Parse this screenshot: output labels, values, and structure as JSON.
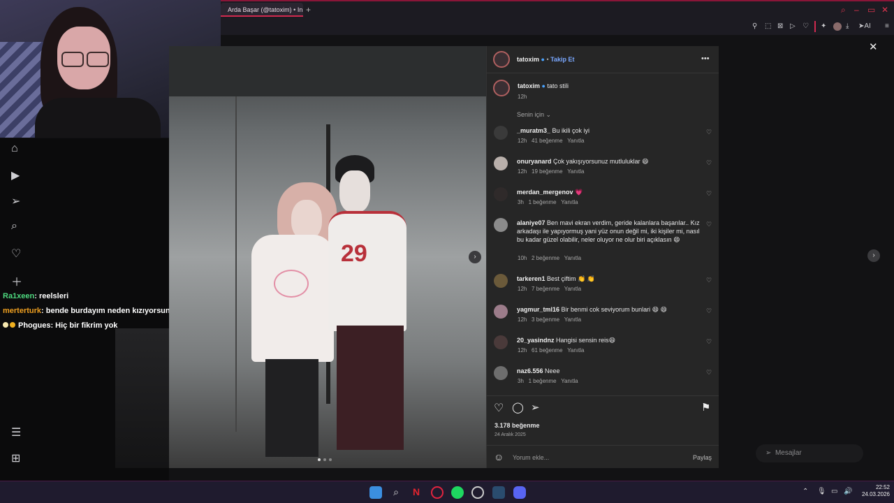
{
  "browser": {
    "tab_title": "Arda Başar (@tatoxim) • In",
    "tab_plus": "+",
    "ai_label": "AI"
  },
  "chat": {
    "messages": [
      {
        "user": "Ra1xeen",
        "text": ": reelsleri",
        "color": "#4ed97f"
      },
      {
        "user": "merterturk",
        "text": ": bende burdayım neden kızıyorsun ki",
        "color": "#f0a020"
      },
      {
        "user": "Phogues",
        "text": ": Hiç bir fikrim yok",
        "color": "#ffffff"
      }
    ]
  },
  "post": {
    "author": "tatoxim",
    "follow_label": "Takip Et",
    "caption": "tato stili",
    "caption_time": "12h",
    "filter_label": "Senin için",
    "likes": "3.178 beğenme",
    "date": "24 Aralık 2025",
    "comment_placeholder": "Yorum ekle...",
    "share_label": "Paylaş",
    "jersey_number": "29"
  },
  "comments": [
    {
      "user": "_muratm3_",
      "text": "Bu ikili çok iyi",
      "time": "12h",
      "likes": "41 beğenme",
      "reply": "Yanıtla"
    },
    {
      "user": "onuryanard",
      "text": "Çok yakışıyorsunuz mutluluklar 😄",
      "time": "12h",
      "likes": "19 beğenme",
      "reply": "Yanıtla"
    },
    {
      "user": "merdan_mergenov",
      "text": "💗",
      "time": "3h",
      "likes": "1 beğenme",
      "reply": "Yanıtla"
    },
    {
      "user": "alaniye07",
      "text": "Ben mavi ekran verdim, geride kalanlara başarılar.. Kız arkadaşı ile yapıyormuş yani yüz onun değil mi, iki kişiler mi, nasıl bu kadar güzel olabilir, neler oluyor ne olur biri açıklasın 😄",
      "time": "10h",
      "likes": "2 beğenme",
      "reply": "Yanıtla"
    },
    {
      "user": "tarkeren1",
      "text": "Best çiftim 👏 👏",
      "time": "12h",
      "likes": "7 beğenme",
      "reply": "Yanıtla"
    },
    {
      "user": "yagmur_tml16",
      "text": "Bir benmi cok seviyorum bunlari 😄 😄",
      "time": "12h",
      "likes": "3 beğenme",
      "reply": "Yanıtla"
    },
    {
      "user": "20_yasindnz",
      "text": "Hangisi sensin reis😄",
      "time": "12h",
      "likes": "61 beğenme",
      "reply": "Yanıtla"
    },
    {
      "user": "naz6.556",
      "text": "Neee",
      "time": "3h",
      "likes": "1 beğenme",
      "reply": "Yanıtla"
    }
  ],
  "messages_button": "Mesajlar",
  "clock": {
    "time": "22:52",
    "date": "24.03.2026"
  }
}
